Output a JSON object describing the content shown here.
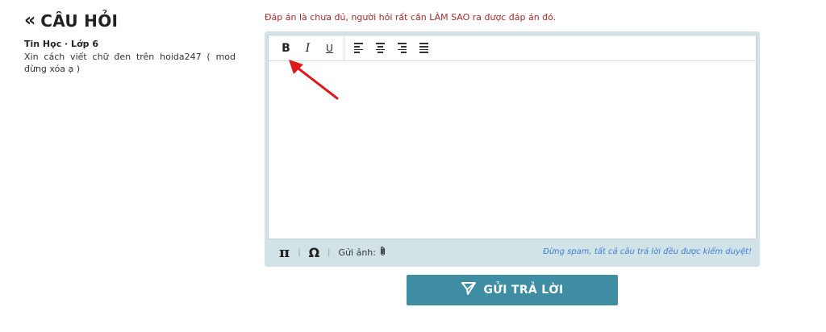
{
  "header": {
    "title": "CÂU HỎI",
    "back_icon": "double-chevron-left-icon"
  },
  "question": {
    "subject": "Tin Học · Lớp 6",
    "text": "Xin cách viết chữ đen trên hoida247 ( mod đừng xóa ạ )"
  },
  "answer": {
    "note": "Đáp án là chưa đủ, người hỏi rất cần LÀM SAO ra được đáp án đó.",
    "toolbar": {
      "bold": "B",
      "italic": "I",
      "underline": "U",
      "align_icons": [
        "align-left-icon",
        "align-center-icon",
        "align-right-icon",
        "align-justify-icon"
      ]
    },
    "body_text": "",
    "bottom_bar": {
      "pi": "π",
      "omega": "Ω",
      "send_image_label": "Gửi ảnh:",
      "spam_warning": "Đừng spam, tất cả câu trả lời đều được kiểm duyệt!"
    },
    "submit_label": "GỬI TRẢ LỜI"
  },
  "colors": {
    "accent": "#3e8da3",
    "note": "#a52a2a",
    "editor_frame": "#d2e3e8",
    "annotation_arrow": "#e0191b",
    "spam_text": "#3a7ed6"
  }
}
